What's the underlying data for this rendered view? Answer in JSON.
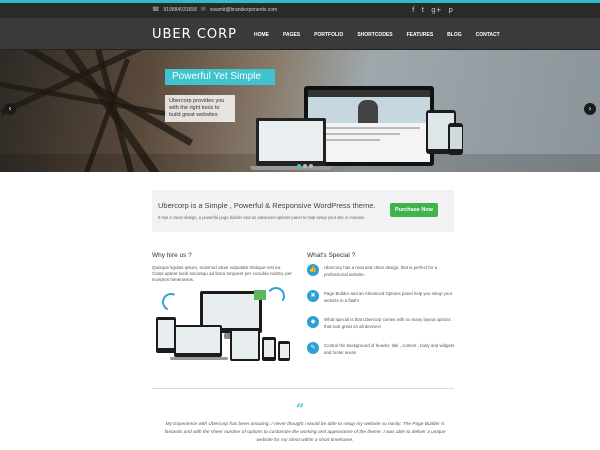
{
  "topbar": {
    "phone": "919884031658",
    "email": "swamit@brandexponents.com",
    "social_icons": [
      "facebook-icon",
      "twitter-icon",
      "google-plus-icon",
      "pinterest-icon"
    ]
  },
  "header": {
    "logo": "UBER CORP",
    "nav": [
      "HOME",
      "PAGES",
      "PORTFOLIO",
      "SHORTCODES",
      "FEATURES",
      "BLOG",
      "CONTACT"
    ]
  },
  "hero": {
    "title": "Powerful Yet Simple",
    "text": "Ubercorp provides you with the right tools to build great websites",
    "prev": "‹",
    "next": "›"
  },
  "promo": {
    "headline": "Ubercorp is a Simple , Powerful & Responsive WordPress theme.",
    "sub": "It has a clean design, a powerful page builder and an advanced options panel to help setup your site in minutes.",
    "button": "Purchase Now"
  },
  "why": {
    "title": "Why hire us ?",
    "text": "Quisque ligulas ipsum, euismod atras vulputate tristique nisl eu. Class aptent taciti sociosqu ad litora torquent per conubia nostra, per inceptos himenaeos."
  },
  "special": {
    "title": "What's Special ?",
    "items": [
      {
        "icon": "thumbs-up-icon",
        "glyph": "👍",
        "text": "Ubercorp has a neat and clean design, that is perfect for a professional website."
      },
      {
        "icon": "tools-icon",
        "glyph": "✖",
        "text": "Page Builder and an Advanced Options panel help you setup your website in a flash!"
      },
      {
        "icon": "tag-icon",
        "glyph": "◆",
        "text": "What special is that Ubercorp comes with so many layout options that look great on all devices!"
      },
      {
        "icon": "pencil-icon",
        "glyph": "✎",
        "text": "Control the background of header, title , content , body and widgets and footer areas"
      }
    ]
  },
  "testimonial": {
    "mark": "”",
    "text": "My Experience with Ubercorp has been amazing. I never thought i would be able to setup my website so easily. The Page Builder is fantastic and with the sheer number of options to customize the working and appearance of the theme, I was able to deliver a unique website for my client within a short timeframe."
  },
  "colors": {
    "accent": "#3ec3cf",
    "button": "#40b34f",
    "icon": "#2ba0d6"
  }
}
